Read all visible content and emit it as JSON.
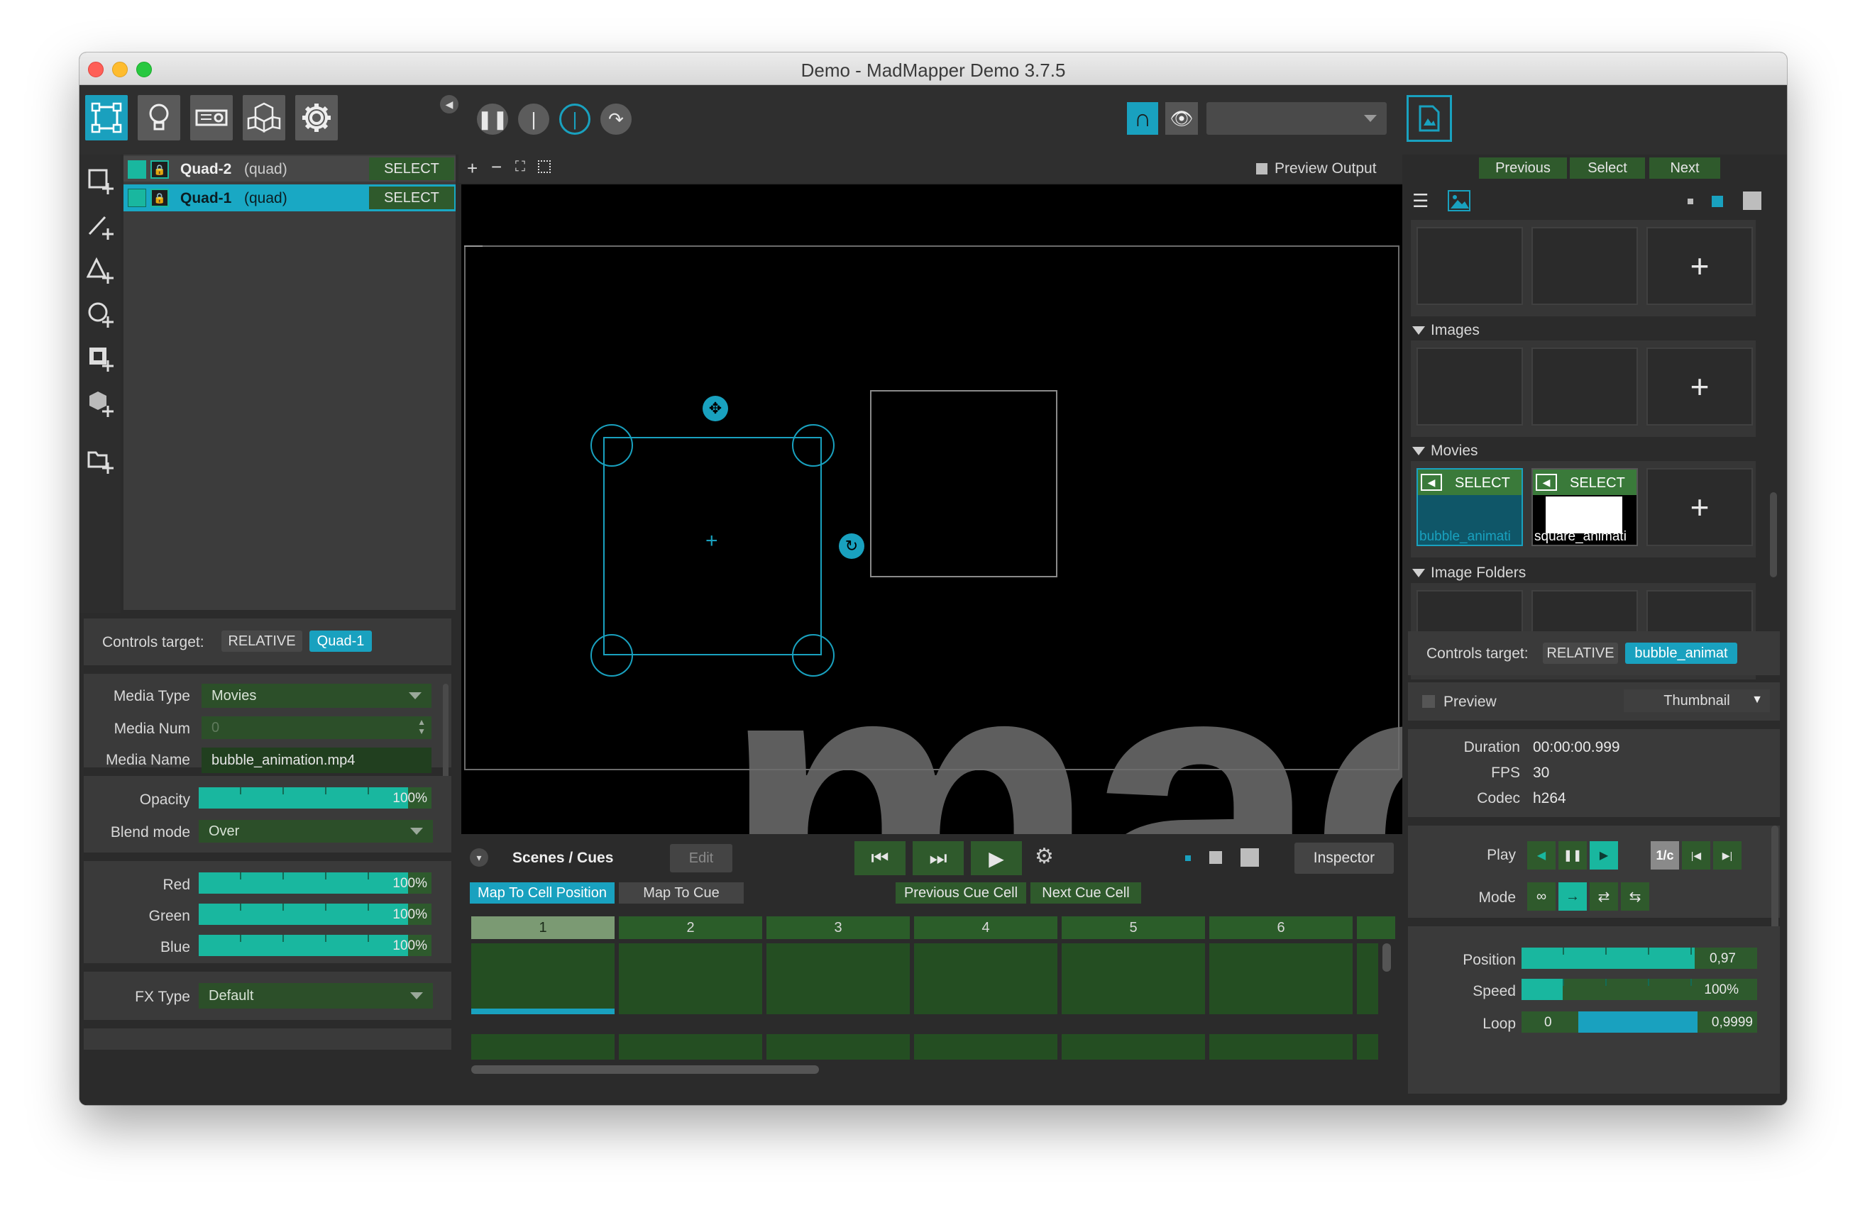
{
  "window": {
    "title": "Demo - MadMapper Demo 3.7.5"
  },
  "toolbar": {
    "mode_icons": [
      "surfaces-icon",
      "lights-icon",
      "projector-icon",
      "3d-objects-icon",
      "settings-gear-icon"
    ],
    "view_dropdown_value": ""
  },
  "surfaces": [
    {
      "name": "Quad-2",
      "type": "(quad)",
      "select_label": "SELECT",
      "selected": false
    },
    {
      "name": "Quad-1",
      "type": "(quad)",
      "select_label": "SELECT",
      "selected": true
    }
  ],
  "left_controls": {
    "controls_target_label": "Controls target:",
    "relative_label": "RELATIVE",
    "target_value": "Quad-1",
    "media_type_label": "Media Type",
    "media_type_value": "Movies",
    "media_num_label": "Media Num",
    "media_num_value": "0",
    "media_name_label": "Media Name",
    "media_name_value": "bubble_animation.mp4",
    "opacity_label": "Opacity",
    "opacity_value": "100%",
    "blend_mode_label": "Blend mode",
    "blend_mode_value": "Over",
    "red_label": "Red",
    "red_value": "100%",
    "green_label": "Green",
    "green_value": "100%",
    "blue_label": "Blue",
    "blue_value": "100%",
    "fx_type_label": "FX Type",
    "fx_type_value": "Default",
    "levels": {
      "opacity": 1.0,
      "red": 1.0,
      "green": 1.0,
      "blue": 1.0
    }
  },
  "canvas": {
    "preview_output_label": "Preview Output",
    "tools": [
      "+",
      "−",
      "fit-icon",
      "select-rect-icon"
    ],
    "watermark_text": "mad"
  },
  "cues": {
    "title": "Scenes / Cues",
    "edit_label": "Edit",
    "inspector_label": "Inspector",
    "map_to_cell_position": "Map To Cell Position",
    "map_to_cue": "Map To Cue",
    "previous_cue_cell": "Previous Cue Cell",
    "next_cue_cell": "Next Cue Cell",
    "columns": [
      "1",
      "2",
      "3",
      "4",
      "5",
      "6"
    ]
  },
  "media_browser": {
    "previous_label": "Previous",
    "select_label": "Select",
    "next_label": "Next",
    "images_label": "Images",
    "movies_label": "Movies",
    "image_folders_label": "Image Folders",
    "movies": [
      {
        "name": "bubble_animati",
        "select_label": "SELECT"
      },
      {
        "name": "square_animati",
        "select_label": "SELECT"
      }
    ]
  },
  "inspector": {
    "controls_target_label": "Controls target:",
    "relative_label": "RELATIVE",
    "target_value": "bubble_animat",
    "preview_label": "Preview",
    "thumbnail_label": "Thumbnail",
    "duration_label": "Duration",
    "duration_value": "00:00:00.999",
    "fps_label": "FPS",
    "fps_value": "30",
    "codec_label": "Codec",
    "codec_value": "h264",
    "play_label": "Play",
    "mode_label": "Mode",
    "one_over_c": "1/c",
    "position_label": "Position",
    "position_value": "0,97",
    "speed_label": "Speed",
    "speed_value": "100%",
    "loop_label": "Loop",
    "loop_start": "0",
    "loop_end": "0,9999"
  },
  "colors": {
    "accent_blue": "#19a1bf",
    "green_button": "#2f5a2c",
    "slider_fill": "#19b79f",
    "selected_row": "#19a8c4"
  }
}
